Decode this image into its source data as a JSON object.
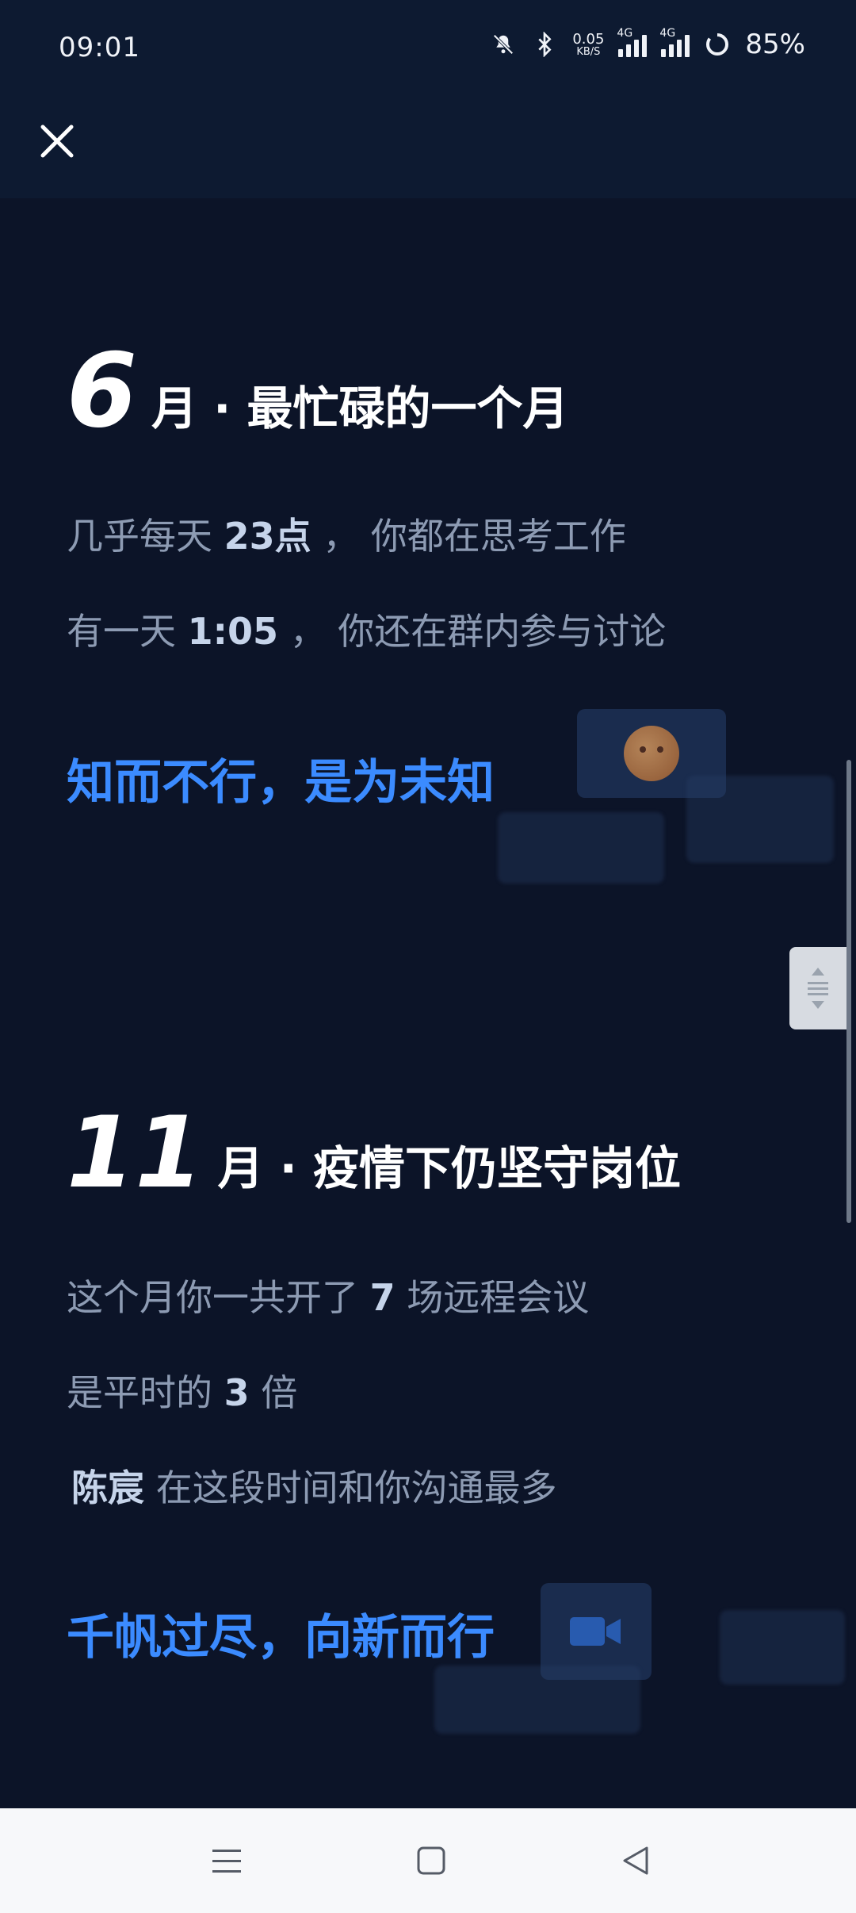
{
  "status_bar": {
    "time": "09:01",
    "speed_value": "0.05",
    "speed_unit": "KB/S",
    "network_1": "4G",
    "network_2": "4G",
    "battery": "85%"
  },
  "colors": {
    "background": "#0c1428",
    "accent": "#3b8bff",
    "muted_text": "#8d9bb3",
    "highlight_text": "#c6d4ea"
  },
  "june": {
    "month_number": "6",
    "title": "月 · 最忙碌的一个月",
    "line1_pre": "几乎每天",
    "line1_value": "23点",
    "line1_post": "， 你都在思考工作",
    "line2_pre": "有一天",
    "line2_value": "1:05",
    "line2_post": "， 你还在群内参与讨论",
    "slogan": "知而不行，是为未知"
  },
  "november": {
    "month_number": "11",
    "title": "月 · 疫情下仍坚守岗位",
    "line1_pre": "这个月你一共开了",
    "line1_value": "7",
    "line1_post": "场远程会议",
    "line2_pre": "是平时的",
    "line2_value": "3",
    "line2_post": "倍",
    "line3_name": "陈宸",
    "line3_post": "在这段时间和你沟通最多",
    "slogan": "千帆过尽，向新而行"
  },
  "icons": {
    "close": "close-icon",
    "menu": "menu-icon",
    "home": "home-icon",
    "back": "back-icon"
  }
}
